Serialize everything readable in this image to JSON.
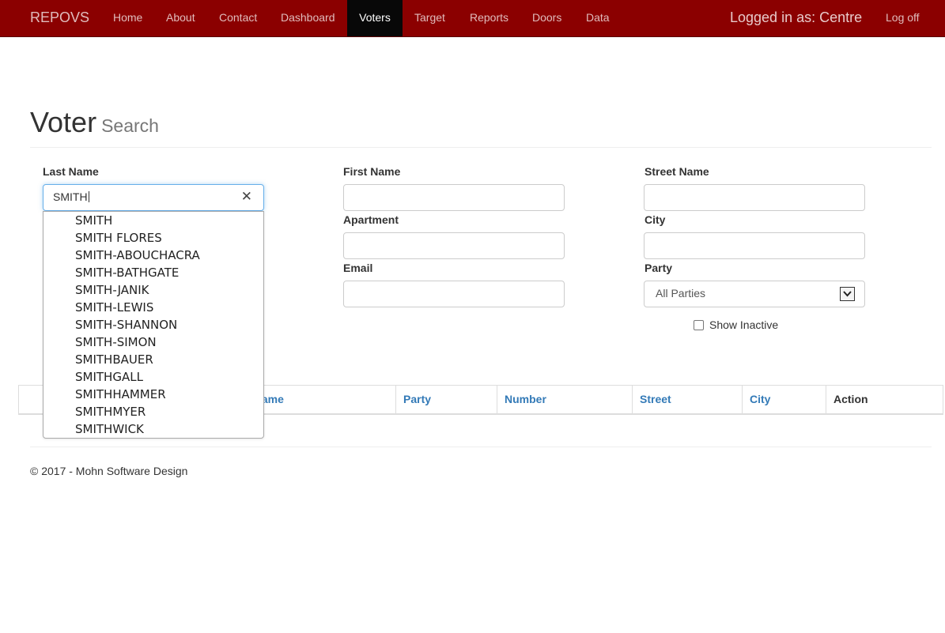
{
  "navbar": {
    "brand": "REPOVS",
    "items": [
      {
        "label": "Home"
      },
      {
        "label": "About"
      },
      {
        "label": "Contact"
      },
      {
        "label": "Dashboard"
      },
      {
        "label": "Voters",
        "active": true
      },
      {
        "label": "Target"
      },
      {
        "label": "Reports"
      },
      {
        "label": "Doors"
      },
      {
        "label": "Data"
      }
    ],
    "user": "Logged in as: Centre",
    "logoff": "Log off"
  },
  "header": {
    "title": "Voter",
    "subtitle": "Search"
  },
  "form": {
    "last_name": {
      "label": "Last Name",
      "value": "SMITH"
    },
    "first_name": {
      "label": "First Name",
      "value": ""
    },
    "street_name": {
      "label": "Street Name",
      "value": ""
    },
    "apartment": {
      "label": "Apartment",
      "value": ""
    },
    "city": {
      "label": "City",
      "value": ""
    },
    "email": {
      "label": "Email",
      "value": ""
    },
    "party": {
      "label": "Party",
      "selected": "All Parties"
    },
    "show_inactive": {
      "label": "Show Inactive",
      "checked": false
    }
  },
  "autocomplete": {
    "items": [
      "SMITH",
      "SMITH FLORES",
      "SMITH-ABOUCHACRA",
      "SMITH-BATHGATE",
      "SMITH-JANIK",
      "SMITH-LEWIS",
      "SMITH-SHANNON",
      "SMITH-SIMON",
      "SMITHBAUER",
      "SMITHGALL",
      "SMITHHAMMER",
      "SMITHMYER",
      "SMITHWICK"
    ]
  },
  "table": {
    "columns": [
      "Name",
      "Party",
      "Number",
      "Street",
      "City",
      "Action"
    ],
    "visible_column_fragment": "lame"
  },
  "footer": {
    "text": "© 2017 - Mohn Software Design"
  },
  "colors": {
    "navbar": "#8b0000",
    "active_nav": "#080808",
    "link": "#337ab7"
  }
}
